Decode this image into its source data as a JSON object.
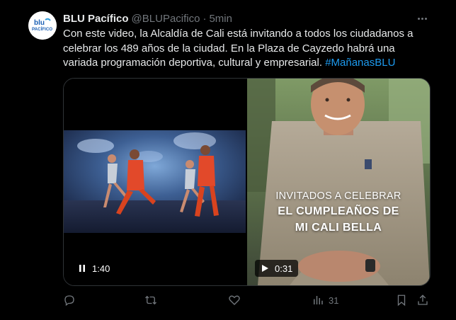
{
  "tweet": {
    "author_name": "BLU Pacífico",
    "handle": "@BLUPacifico",
    "separator": "·",
    "time": "5min",
    "avatar_text": "PACÍFICO",
    "text": "Con este video, la Alcaldía de Cali está invitando a todos los ciudadanos a celebrar los 489 años de la ciudad. En la Plaza de Cayzedo habrá una variada programación deportiva, cultural y empresarial.",
    "hashtag": "#MañanasBLU"
  },
  "media": {
    "left_video": {
      "duration": "1:40",
      "state": "playing"
    },
    "right_video": {
      "duration": "0:31",
      "state": "paused",
      "overlay_line1": "INVITADOS A CELEBRAR",
      "overlay_line2": "EL CUMPLEAÑOS DE",
      "overlay_line3": "MI CALI BELLA"
    }
  },
  "actions": {
    "views_count": "31"
  },
  "colors": {
    "background": "#000000",
    "text": "#e7e9ea",
    "muted": "#71767b",
    "link": "#1d9bf0",
    "border": "#2f3336"
  }
}
